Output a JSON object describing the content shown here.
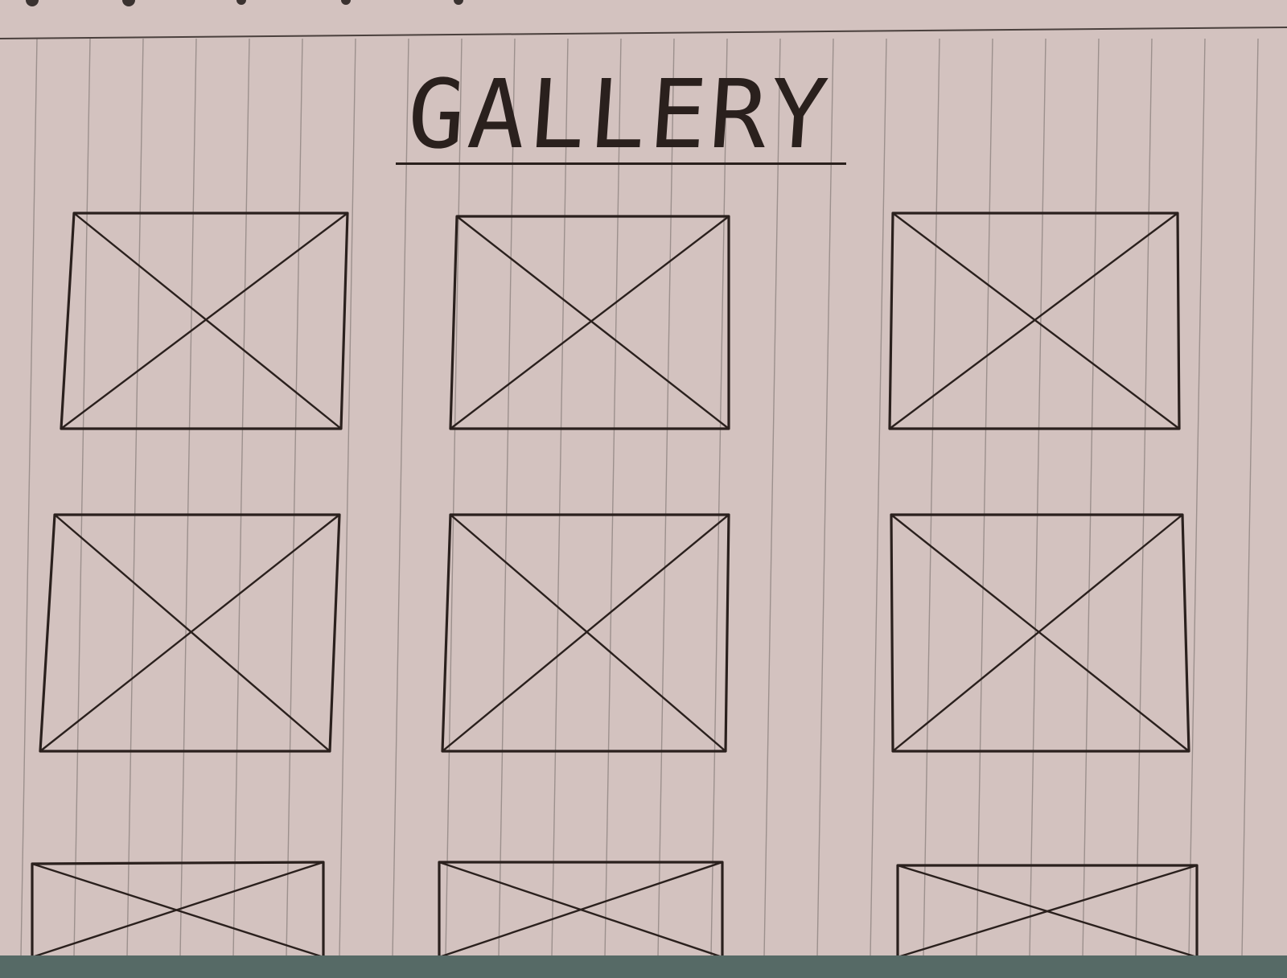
{
  "page": {
    "title": "GALLERY",
    "paper_color": "#d3c2bf",
    "ruling_color": "#9c908d",
    "ink_color": "#2a201d"
  },
  "gallery": {
    "rows": 3,
    "columns": 3,
    "items": [
      {
        "type": "image-placeholder"
      },
      {
        "type": "image-placeholder"
      },
      {
        "type": "image-placeholder"
      },
      {
        "type": "image-placeholder"
      },
      {
        "type": "image-placeholder"
      },
      {
        "type": "image-placeholder"
      },
      {
        "type": "image-placeholder"
      },
      {
        "type": "image-placeholder"
      },
      {
        "type": "image-placeholder"
      }
    ]
  }
}
